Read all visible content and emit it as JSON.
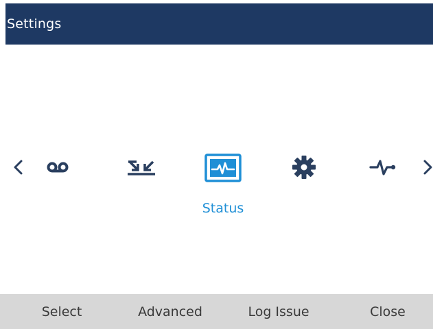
{
  "header": {
    "title": "Settings"
  },
  "carousel": {
    "prev_icon": "chevron-left-icon",
    "next_icon": "chevron-right-icon",
    "items": [
      {
        "icon": "voicemail-icon",
        "selected": false
      },
      {
        "icon": "call-forward-icon",
        "selected": false
      },
      {
        "icon": "status-icon",
        "selected": true
      },
      {
        "icon": "gear-icon",
        "selected": false
      },
      {
        "icon": "diagnostics-icon",
        "selected": false
      }
    ],
    "selected_label": "Status",
    "accent_color": "#1f8fd6"
  },
  "softkeys": {
    "select": "Select",
    "advanced": "Advanced",
    "log_issue": "Log Issue",
    "close": "Close"
  },
  "colors": {
    "header_bg": "#1e3963",
    "softkey_bg": "#d7d7d7",
    "icon_color": "#2a3f5f"
  }
}
